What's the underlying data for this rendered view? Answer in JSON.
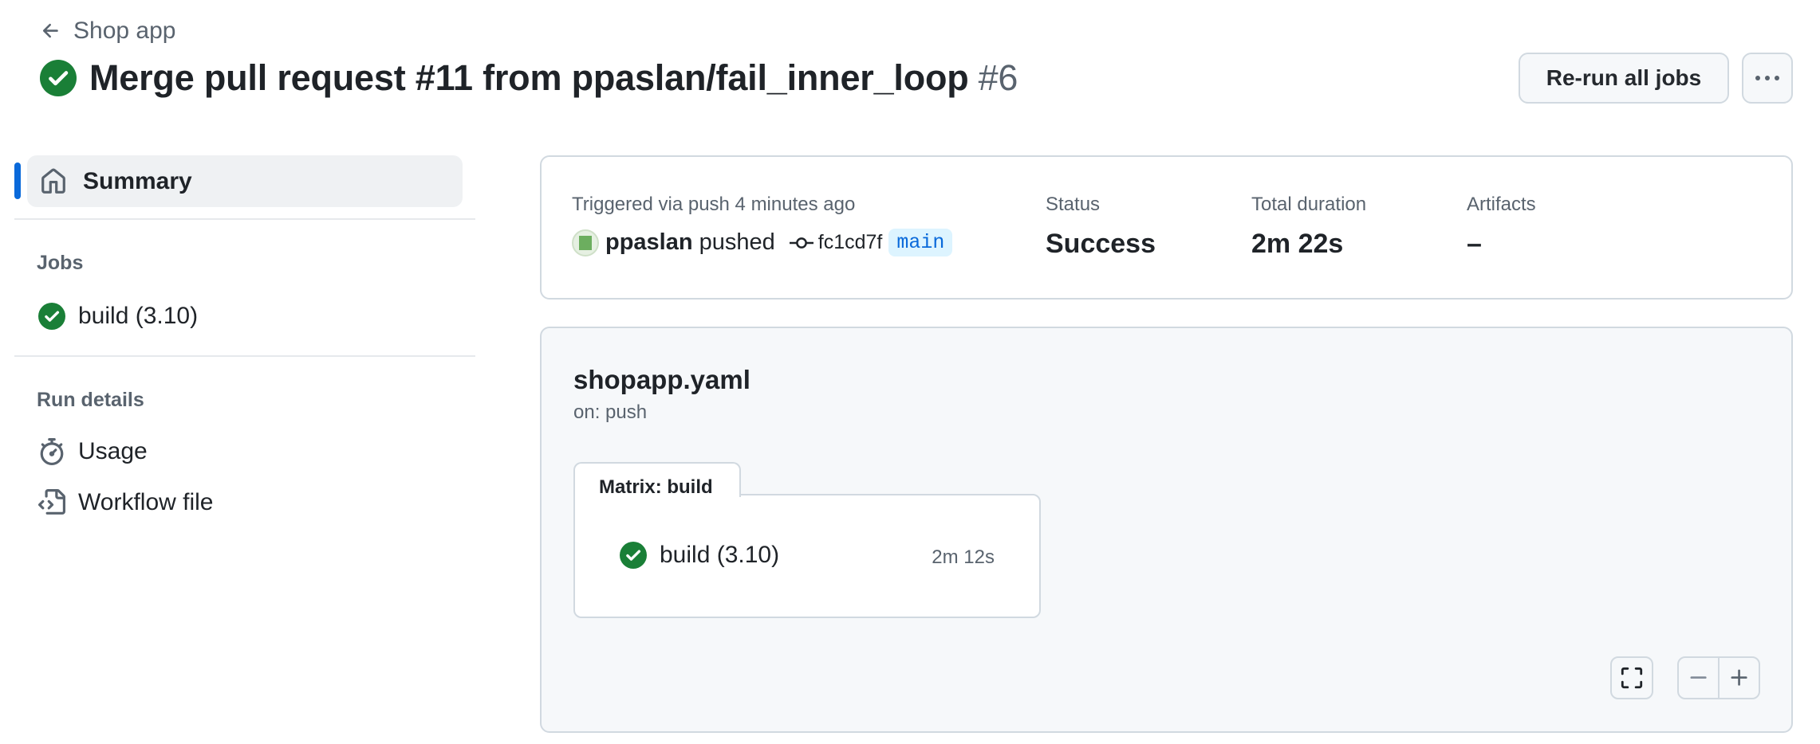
{
  "header": {
    "back_label": "Shop app",
    "run_title": "Merge pull request #11 from ppaslan/fail_inner_loop",
    "run_number": "#6",
    "rerun_label": "Re-run all jobs",
    "status_icon": "check-circle-fill-icon"
  },
  "sidebar": {
    "summary_label": "Summary",
    "jobs_heading": "Jobs",
    "jobs": [
      {
        "label": "build (3.10)",
        "status": "success"
      }
    ],
    "run_details_heading": "Run details",
    "run_details": [
      {
        "label": "Usage",
        "icon": "stopwatch-icon"
      },
      {
        "label": "Workflow file",
        "icon": "file-code-icon"
      }
    ]
  },
  "summary": {
    "trigger_text": "Triggered via push 4 minutes ago",
    "actor": "ppaslan",
    "action": "pushed",
    "commit": "fc1cd7f",
    "branch": "main",
    "status_label": "Status",
    "status_value": "Success",
    "duration_label": "Total duration",
    "duration_value": "2m 22s",
    "artifacts_label": "Artifacts",
    "artifacts_value": "–"
  },
  "workflow": {
    "file_name": "shopapp.yaml",
    "trigger": "on: push",
    "matrix_label": "Matrix: build",
    "job_name": "build (3.10)",
    "job_duration": "2m 12s"
  },
  "colors": {
    "success": "#1a7f37",
    "accent": "#0969da",
    "muted": "#59636e"
  }
}
